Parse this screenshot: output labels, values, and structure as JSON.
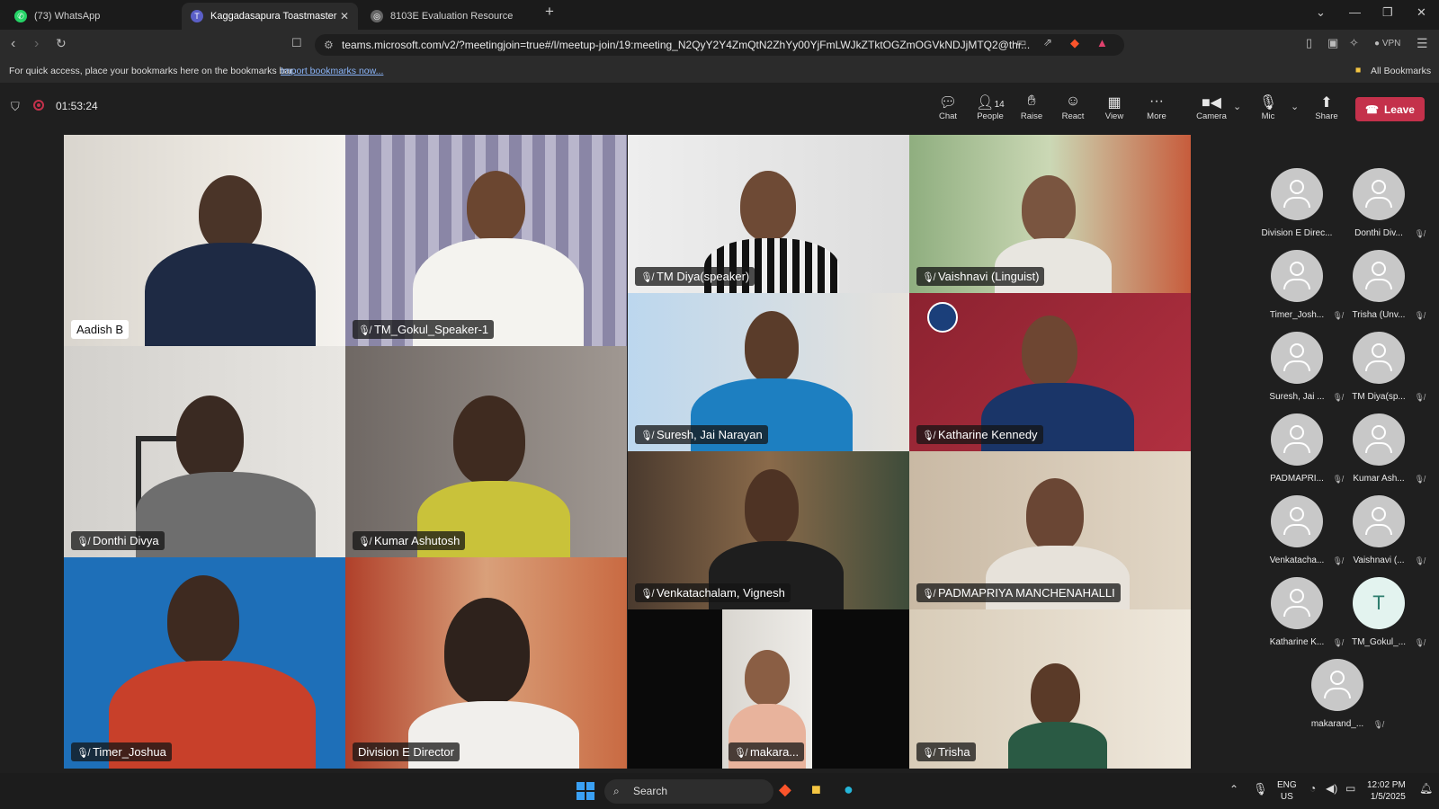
{
  "browser": {
    "tabs": [
      {
        "label": "(73) WhatsApp",
        "icon": "whatsapp-icon"
      },
      {
        "label": "Kaggadasapura Toastmaster",
        "icon": "teams-icon"
      },
      {
        "label": "8103E Evaluation Resource",
        "icon": "globe-icon"
      }
    ],
    "url": "teams.microsoft.com/v2/?meetingjoin=true#/l/meetup-join/19:meeting_N2QyY2Y4ZmQtN2ZhYy00YjFmLWJkZTktOGZmOGVkNDJjMTQ2@thr...",
    "vpn_label": "VPN",
    "bookmarks_text": "For quick access, place your bookmarks here on the bookmarks bar.",
    "bookmarks_link": "Import bookmarks now...",
    "all_bookmarks": "All Bookmarks"
  },
  "meeting": {
    "timer": "01:53:24",
    "people_count": "14",
    "toolbar": {
      "chat": "Chat",
      "people": "People",
      "raise": "Raise",
      "react": "React",
      "view": "View",
      "more": "More",
      "camera": "Camera",
      "mic": "Mic",
      "share": "Share",
      "leave": "Leave"
    },
    "tiles": [
      {
        "name": "Aadish B"
      },
      {
        "name": "TM_Gokul_Speaker-1"
      },
      {
        "name": "TM Diya(speaker)"
      },
      {
        "name": "Vaishnavi (Linguist)"
      },
      {
        "name": "Suresh, Jai Narayan"
      },
      {
        "name": "Katharine Kennedy"
      },
      {
        "name": "Donthi Divya"
      },
      {
        "name": "Kumar Ashutosh"
      },
      {
        "name": "Venkatachalam, Vignesh"
      },
      {
        "name": "PADMAPRIYA MANCHENAHALLI"
      },
      {
        "name": "Timer_Joshua"
      },
      {
        "name": "Division E Director"
      },
      {
        "name": "makara..."
      },
      {
        "name": "Trisha"
      }
    ],
    "roster": [
      {
        "name": "Division E Direc...",
        "muted": false
      },
      {
        "name": "Donthi Div...",
        "muted": true
      },
      {
        "name": "Timer_Josh...",
        "muted": true
      },
      {
        "name": "Trisha (Unv...",
        "muted": true
      },
      {
        "name": "Suresh, Jai ...",
        "muted": true
      },
      {
        "name": "TM Diya(sp...",
        "muted": true
      },
      {
        "name": "PADMAPRI...",
        "muted": true
      },
      {
        "name": "Kumar Ash...",
        "muted": true
      },
      {
        "name": "Venkatacha...",
        "muted": true
      },
      {
        "name": "Vaishnavi (...",
        "muted": true
      },
      {
        "name": "Katharine K...",
        "muted": true
      },
      {
        "name": "TM_Gokul_...",
        "muted": true,
        "initial": "T"
      },
      {
        "name": "makarand_...",
        "muted": true
      }
    ]
  },
  "taskbar": {
    "search": "Search",
    "lang": "ENG",
    "region": "US",
    "time": "12:02 PM",
    "date": "1/5/2025"
  }
}
